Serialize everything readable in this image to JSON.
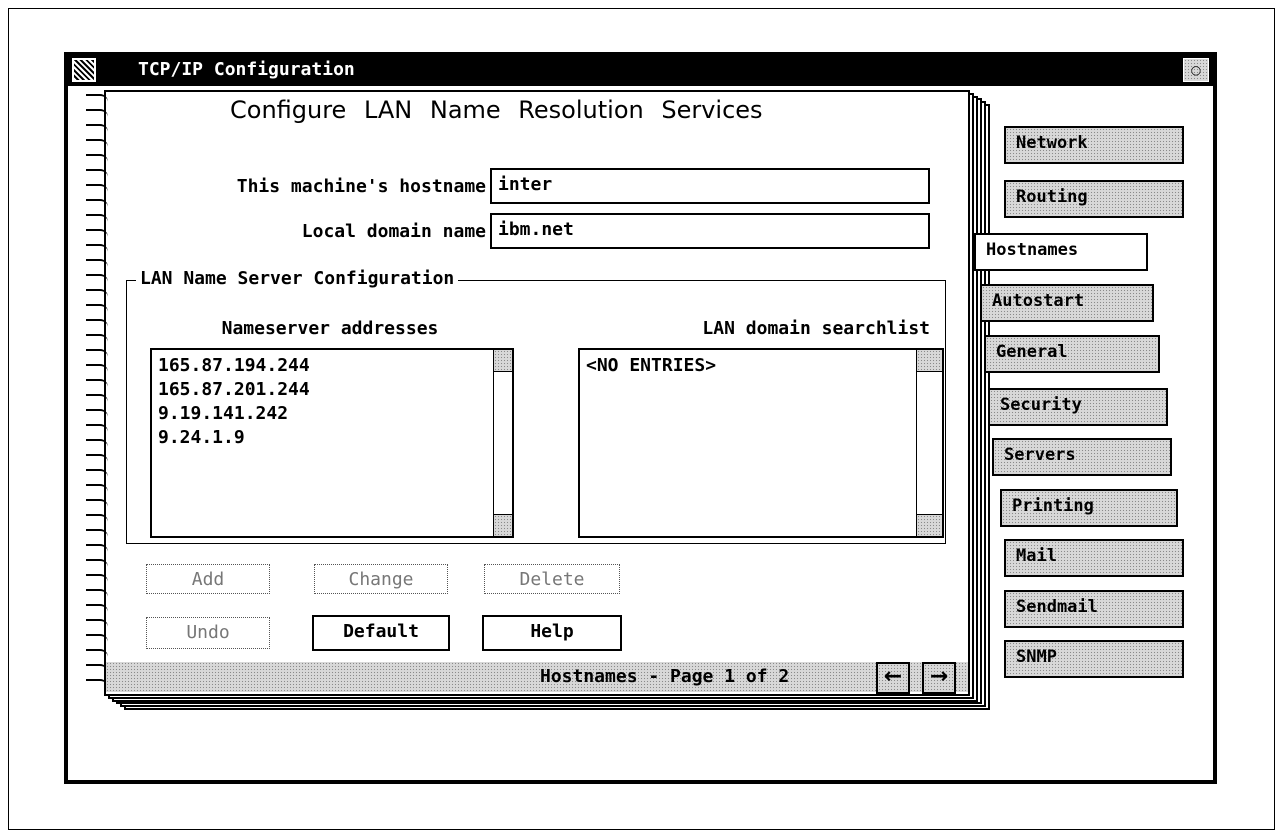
{
  "window": {
    "title": "TCP/IP Configuration"
  },
  "page": {
    "heading": "Configure LAN Name Resolution Services",
    "hostname_label": "This machine's hostname",
    "hostname_value": "inter",
    "domain_label": "Local domain name",
    "domain_value": "ibm.net",
    "group_label": "LAN Name Server Configuration",
    "nameserver_header": "Nameserver addresses",
    "nameservers": [
      "165.87.194.244",
      "165.87.201.244",
      "9.19.141.242",
      "9.24.1.9"
    ],
    "searchlist_header": "LAN domain searchlist",
    "searchlist": [
      "<NO ENTRIES>"
    ]
  },
  "buttons": {
    "add": "Add",
    "change": "Change",
    "delete": "Delete",
    "undo": "Undo",
    "default": "Default",
    "help": "Help"
  },
  "status": {
    "text": "Hostnames - Page 1 of 2"
  },
  "tabs": [
    "Network",
    "Routing",
    "Hostnames",
    "Autostart",
    "General",
    "Security",
    "Servers",
    "Printing",
    "Mail",
    "Sendmail",
    "SNMP"
  ],
  "active_tab": "Hostnames",
  "icons": {
    "prev_page": "left-arrow-icon",
    "next_page": "right-arrow-icon",
    "system_menu": "system-menu-icon",
    "minimize": "minimize-icon"
  }
}
